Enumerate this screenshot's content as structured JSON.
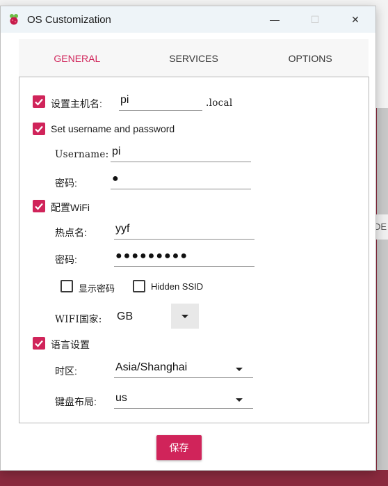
{
  "window": {
    "title": "OS Customization",
    "minimize": "—",
    "maximize": "☐",
    "close": "✕"
  },
  "background": {
    "chip_text": "DE"
  },
  "tabs": [
    {
      "label": "GENERAL",
      "active": true
    },
    {
      "label": "SERVICES",
      "active": false
    },
    {
      "label": "OPTIONS",
      "active": false
    }
  ],
  "hostname": {
    "label": "设置主机名:",
    "value": "pi",
    "suffix": ".local",
    "checked": true
  },
  "user": {
    "checkbox_label": "Set username and password",
    "checked": true,
    "username_label": "Username:",
    "username_value": "pi",
    "password_label": "密码:",
    "password_value": "●"
  },
  "wifi": {
    "checkbox_label": "配置WiFi",
    "checked": true,
    "ssid_label": "热点名:",
    "ssid_value": "yyf",
    "password_label": "密码:",
    "password_value": "●●●●●●●●●",
    "show_password_label": "显示密码",
    "show_password_checked": false,
    "hidden_ssid_label": "Hidden SSID",
    "hidden_ssid_checked": false,
    "country_label": "WIFI国家:",
    "country_value": "GB"
  },
  "locale": {
    "checkbox_label": "语言设置",
    "checked": true,
    "timezone_label": "时区:",
    "timezone_value": "Asia/Shanghai",
    "keyboard_label": "键盘布局:",
    "keyboard_value": "us"
  },
  "footer": {
    "save_label": "保存"
  },
  "colors": {
    "accent": "#d0245a",
    "titlebar": "#eef4f8",
    "background_app": "#8a2a3e"
  },
  "icons": [
    "raspberry-pi-app-icon",
    "check-icon",
    "chevron-down-icon"
  ]
}
